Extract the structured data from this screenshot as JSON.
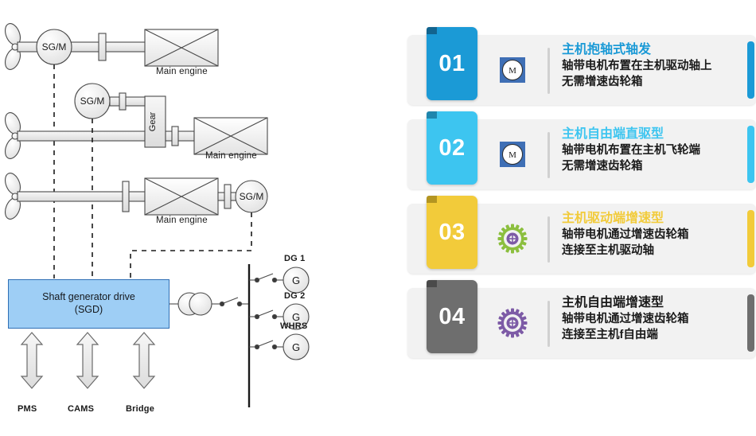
{
  "diagram": {
    "rows": [
      {
        "id": "row1",
        "engine_label": "Main engine",
        "machine_label": "SG/M"
      },
      {
        "id": "row2",
        "engine_label": "Main engine",
        "machine_label": "SG/M",
        "gear_label": "Gear"
      },
      {
        "id": "row3",
        "engine_label": "Main engine",
        "machine_label": "SG/M"
      }
    ],
    "sgd": {
      "line1": "Shaft generator drive",
      "line2": "(SGD)"
    },
    "interfaces": [
      "PMS",
      "CAMS",
      "Bridge"
    ],
    "generators": [
      {
        "label": "DG 1",
        "symbol": "G"
      },
      {
        "label": "DG 2",
        "symbol": "G"
      },
      {
        "label": "WHRS",
        "symbol": "G"
      }
    ],
    "colors": {
      "sgd_fill": "#9ecef5",
      "sgd_border": "#2f6fb5",
      "line": "#4a4a4a"
    }
  },
  "cards": [
    {
      "number": "01",
      "title": "主机抱轴式轴发",
      "lines": [
        "轴带电机布置在主机驱动轴上",
        "无需增速齿轮箱"
      ],
      "icon": "motor-icon",
      "icon_letter": "M",
      "badge_color": "#1b9ad6",
      "fold_color": "#12648f",
      "accent_color": "#1b9ad6",
      "title_color": "#1b9ad6"
    },
    {
      "number": "02",
      "title": "主机自由端直驱型",
      "lines": [
        "轴带电机布置在主机飞轮端",
        "无需增速齿轮箱"
      ],
      "icon": "motor-icon",
      "icon_letter": "M",
      "badge_color": "#3dc5f0",
      "fold_color": "#1f86ad",
      "accent_color": "#3dc5f0",
      "title_color": "#3dc5f0"
    },
    {
      "number": "03",
      "title": "主机驱动端增速型",
      "lines": [
        "轴带电机通过增速齿轮箱",
        "连接至主机驱动轴"
      ],
      "icon": "gear-icon-green",
      "icon_letter": "",
      "badge_color": "#f2cb3a",
      "fold_color": "#b39521",
      "accent_color": "#f2cb3a",
      "title_color": "#f2cb3a"
    },
    {
      "number": "04",
      "title": "主机自由端增速型",
      "lines": [
        "轴带电机通过增速齿轮箱",
        "连接至主机f自由端"
      ],
      "icon": "gear-icon-purple",
      "icon_letter": "",
      "badge_color": "#6e6e6e",
      "fold_color": "#4a4a4a",
      "accent_color": "#6e6e6e",
      "title_color": "#1a1a1a"
    }
  ]
}
